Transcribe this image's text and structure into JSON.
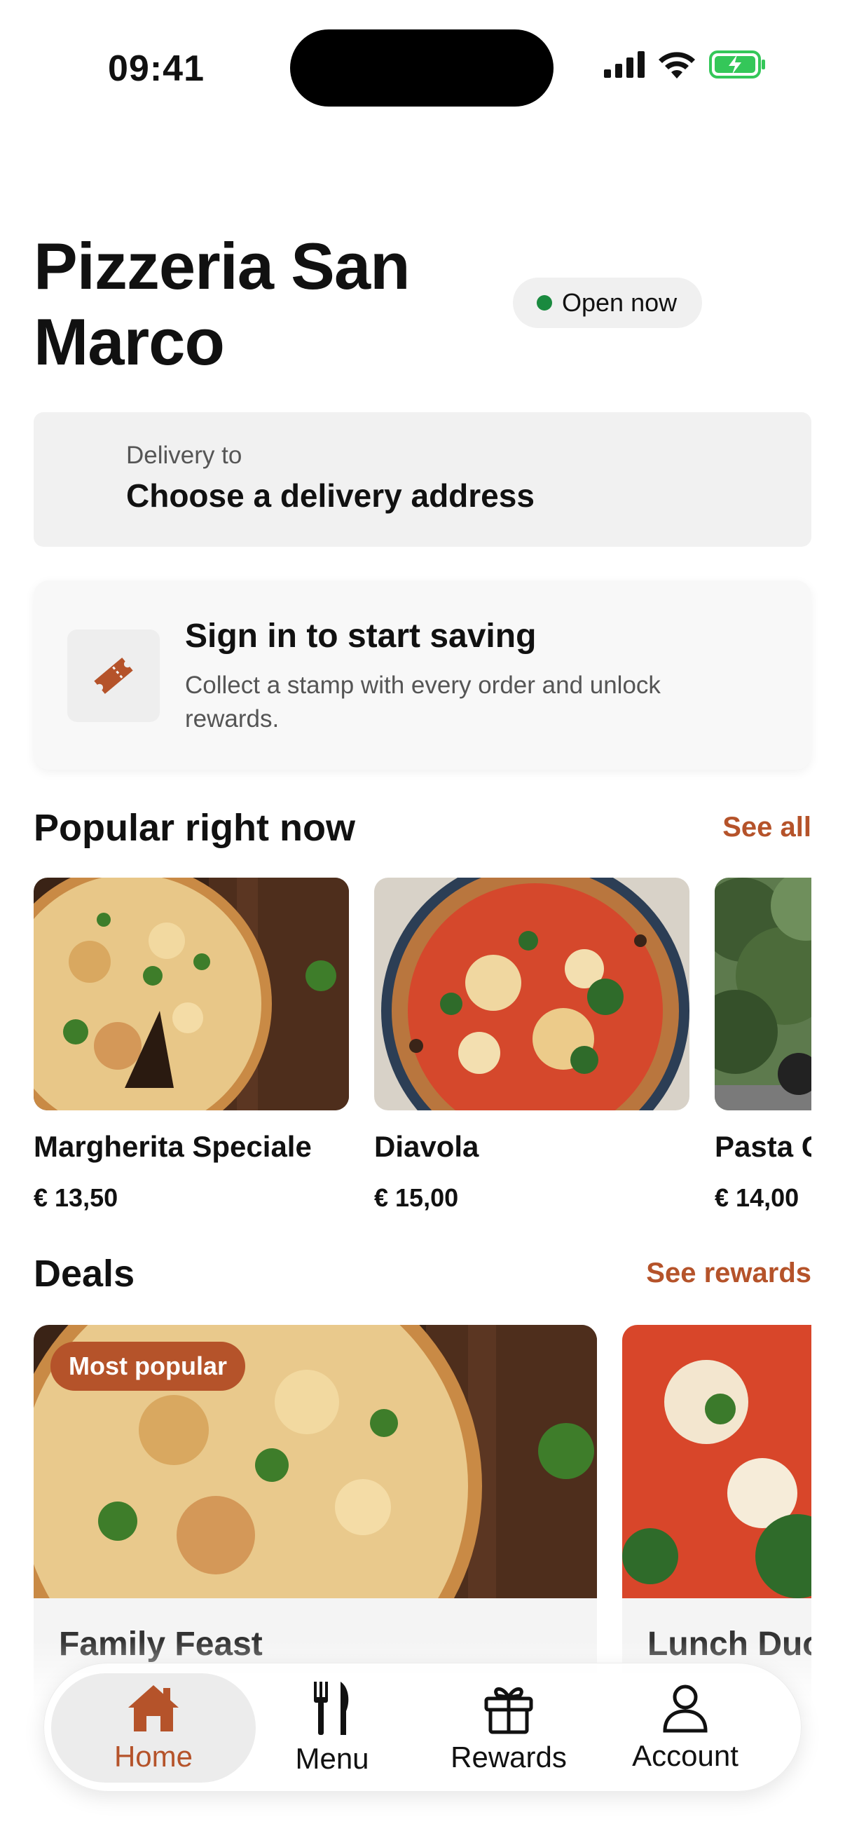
{
  "status_bar": {
    "time": "09:41",
    "icons": [
      "signal-icon",
      "wifi-icon",
      "battery-charging-icon"
    ]
  },
  "header": {
    "title": "Pizzeria San Marco",
    "status_label": "Open now"
  },
  "delivery": {
    "label": "Delivery to",
    "value": "Choose a delivery address"
  },
  "loyalty": {
    "icon": "ticket-icon",
    "title": "Sign in to start saving",
    "description": "Collect a stamp with every order and unlock rewards."
  },
  "popular": {
    "title": "Popular right now",
    "link": "See all",
    "items": [
      {
        "name": "Margherita Speciale",
        "price": "€ 13,50"
      },
      {
        "name": "Diavola",
        "price": "€ 15,00"
      },
      {
        "name": "Pasta C",
        "price": "€ 14,00"
      }
    ]
  },
  "deals": {
    "title": "Deals",
    "link": "See rewards",
    "items": [
      {
        "badge": "Most popular",
        "name": "Family Feast"
      },
      {
        "badge": "",
        "name": "Lunch Duo"
      }
    ]
  },
  "tabbar": {
    "items": [
      {
        "label": "Home",
        "icon": "home-icon",
        "active": true
      },
      {
        "label": "Menu",
        "icon": "fork-knife-icon",
        "active": false
      },
      {
        "label": "Rewards",
        "icon": "gift-icon",
        "active": false
      },
      {
        "label": "Account",
        "icon": "person-icon",
        "active": false
      }
    ]
  },
  "colors": {
    "accent": "#b5532a",
    "open_dot": "#1a8a3f"
  }
}
